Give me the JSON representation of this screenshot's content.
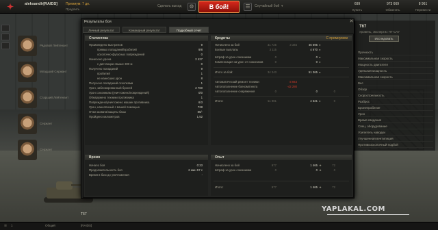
{
  "topbar": {
    "username": "aleksandlr[RAIDS]",
    "rank": "",
    "premium": "Премиум: 7 дн.",
    "premium_buy": "Продлить",
    "exit": "Сделать выход",
    "battle": "В бой!",
    "mode": "Случайный бой",
    "resources": [
      {
        "value": "699",
        "label": "Купить"
      },
      {
        "value": "973 669",
        "label": "Обменять"
      },
      {
        "value": "8 961",
        "label": "Перевести"
      }
    ]
  },
  "crew": [
    {
      "role": "Рядовой Лейтенант"
    },
    {
      "role": "Младший Сержант"
    },
    {
      "role": "Старший Лейтенант"
    },
    {
      "role": "Сержант"
    },
    {
      "role": "Сержант"
    }
  ],
  "right_panel": {
    "tank": "T67",
    "subtitle": "Уровень, Экспертиз ПТ-САУ",
    "research": "Исследовать",
    "items": [
      "Прочность",
      "Максимальная скорость",
      "Мощность двигателя",
      "Удельная мощность",
      "Максимальная скорость",
      "Вес",
      "Обзор",
      "Скорострельность",
      "Разброс",
      "Бронепробитие",
      "Урон",
      "Время сведения",
      "Спец. оборудование",
      "Усилитель наводки",
      "Улучшенная вентиляция",
      "Противоосколочный подбой"
    ]
  },
  "dialog": {
    "title": "Результаты боя",
    "close": "✕",
    "tabs": [
      "Личный результат",
      "Командный результат",
      "Подробный отчет"
    ],
    "stats": {
      "header": "Статистика",
      "rows": [
        {
          "label": "Произведено выстрелов",
          "value": "9",
          "indent": false
        },
        {
          "label": "прямых попаданий/пробитий",
          "value": "9/8",
          "indent": true
        },
        {
          "label": "осколочно-фугасных повреждений",
          "value": "0",
          "indent": true
        },
        {
          "label": "Нанесено урона",
          "value": "2 427",
          "indent": false
        },
        {
          "label": "с дистанции свыше 300 м",
          "value": "0",
          "indent": true
        },
        {
          "label": "Получено попаданий",
          "value": "9",
          "indent": false
        },
        {
          "label": "пробитий",
          "value": "1",
          "indent": true
        },
        {
          "label": "не нанесших урон",
          "value": "8",
          "indent": true
        },
        {
          "label": "Получено попаданий осколками",
          "value": "1",
          "indent": false
        },
        {
          "label": "Урон, заблокированный броней",
          "value": "2 760",
          "indent": false
        },
        {
          "label": "Урон союзникам (уничтожено/повреждений)",
          "value": "0/0",
          "indent": false
        },
        {
          "label": "Обнаружено техники противника",
          "value": "1",
          "indent": false
        },
        {
          "label": "Повреждено/уничтожено машин противника",
          "value": "6/3",
          "indent": false
        },
        {
          "label": "Урон, нанесённый с вашей помощью",
          "value": "728",
          "indent": false
        },
        {
          "label": "Очки захвата/защиты базы",
          "value": "86/-",
          "indent": false
        },
        {
          "label": "Пройдено километров",
          "value": "1,52",
          "indent": false
        }
      ]
    },
    "credits": {
      "header": "Кредиты",
      "premium_label": "С премиумом",
      "rows": [
        {
          "label": "Начислено за бой",
          "c1": "31 725",
          "c2": "3 345",
          "c3": "46 695",
          "c4": "",
          "red": false
        },
        {
          "label": "Боевые выплаты",
          "c1": "3 115",
          "c2": "",
          "c3": "4 670",
          "c4": "",
          "red": false
        },
        {
          "label": "Штраф за урон союзникам",
          "c1": "0",
          "c2": "",
          "c3": "0",
          "c4": "",
          "red": false
        },
        {
          "label": "Компенсация за урон от союзников",
          "c1": "0",
          "c2": "",
          "c3": "0",
          "c4": "",
          "red": false
        },
        {
          "label": "Итого за бой:",
          "c1": "34 243",
          "c2": "",
          "c3": "51 365",
          "c4": "",
          "red": false
        },
        {
          "label": "Автоматический ремонт техники",
          "c1": "",
          "c2": "-3 944",
          "c3": "",
          "c4": "",
          "red": true
        },
        {
          "label": "Автопополнение боекомплекта",
          "c1": "",
          "c2": "-42 280",
          "c3": "",
          "c4": "",
          "red": true
        },
        {
          "label": "Автопополнение снаряжения",
          "c1": "0",
          "c2": "",
          "c3": "0",
          "c4": "0",
          "red": false
        },
        {
          "label": "Итого:",
          "c1": "-11 981",
          "c2": "",
          "c3": "4 621",
          "c4": "0",
          "red": false
        }
      ]
    },
    "time": {
      "header": "Время",
      "rows": [
        {
          "label": "Начало боя",
          "value": "0:33"
        },
        {
          "label": "Продолжительность боя",
          "value": "6 мин 57 с"
        },
        {
          "label": "Время в бою до уничтожения",
          "value": "-"
        }
      ]
    },
    "experience": {
      "header": "Опыт",
      "rows": [
        {
          "label": "Начислено за бой",
          "c1": "977",
          "c3": "1 465",
          "c4": "72"
        },
        {
          "label": "Штраф за урон союзникам",
          "c1": "0",
          "c3": "0",
          "c4": "0"
        },
        {
          "label": "Итого:",
          "c1": "977",
          "c3": "1 465",
          "c4": "72"
        }
      ]
    }
  },
  "tank": {
    "tier": "T67"
  },
  "bottombar": {
    "left": "1",
    "chat": "Общий",
    "clan": "[RAIDS]"
  },
  "watermark": "YAPLAKAL.COM",
  "colors": {
    "accent": "#d8a23a",
    "battle": "#d6281c",
    "negative": "#d23a2a"
  }
}
